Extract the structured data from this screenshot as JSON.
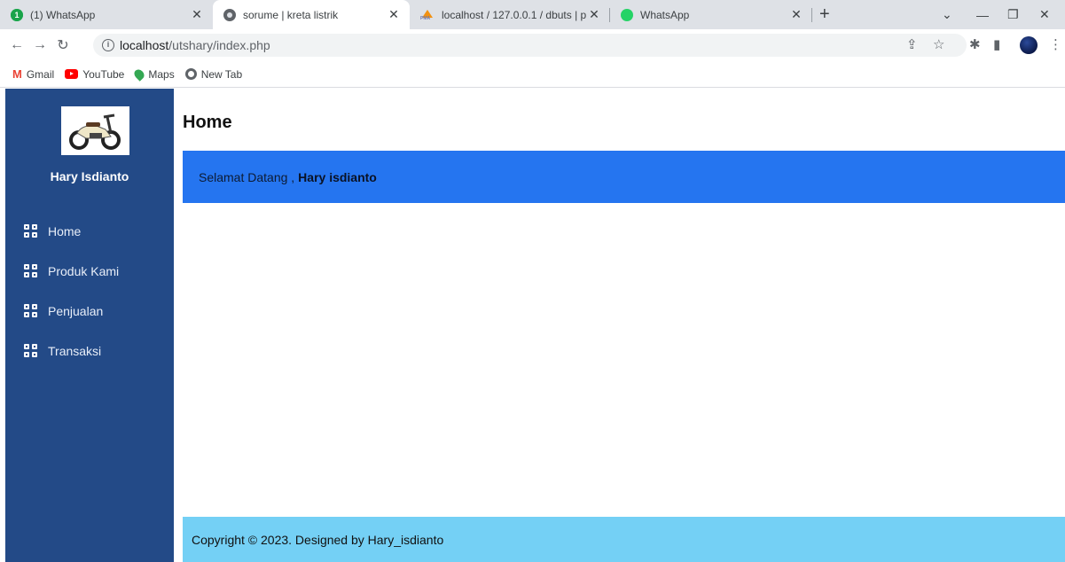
{
  "browser": {
    "tabs": [
      {
        "title": "(1) WhatsApp",
        "badge": "1",
        "icon": "whatsapp-icon",
        "active": false
      },
      {
        "title": "sorume | kreta listrik",
        "icon": "globe-icon",
        "active": true
      },
      {
        "title": "localhost / 127.0.0.1 / dbuts | php",
        "icon": "phpmyadmin-icon",
        "active": false
      },
      {
        "title": "WhatsApp",
        "icon": "whatsapp-icon",
        "active": false
      }
    ],
    "url_host": "localhost",
    "url_path": "/utshary/index.php",
    "bookmarks": [
      {
        "label": "Gmail",
        "icon": "gmail-icon"
      },
      {
        "label": "YouTube",
        "icon": "youtube-icon"
      },
      {
        "label": "Maps",
        "icon": "maps-icon"
      },
      {
        "label": "New Tab",
        "icon": "globe-icon"
      }
    ]
  },
  "sidebar": {
    "user_name": "Hary Isdianto",
    "logo": "scooter-image",
    "menu": [
      {
        "label": "Home",
        "icon": "grid-icon"
      },
      {
        "label": "Produk Kami",
        "icon": "grid-icon"
      },
      {
        "label": "Penjualan",
        "icon": "grid-icon"
      },
      {
        "label": "Transaksi",
        "icon": "grid-icon"
      }
    ]
  },
  "main": {
    "title": "Home",
    "welcome_prefix": "Selamat Datang ,",
    "welcome_name": "Hary isdianto"
  },
  "footer": {
    "text": "Copyright © 2023. Designed by Hary_isdianto"
  },
  "colors": {
    "sidebar": "#234a87",
    "welcome_bar": "#2575f0",
    "footer": "#74d0f5"
  }
}
